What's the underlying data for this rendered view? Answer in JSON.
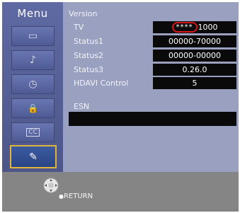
{
  "menu": {
    "title": "Menu",
    "items": [
      {
        "icon": "picture-icon",
        "glyph": "▭"
      },
      {
        "icon": "sound-icon",
        "glyph": "♪"
      },
      {
        "icon": "timer-icon",
        "glyph": "◷"
      },
      {
        "icon": "lock-icon",
        "glyph": "🔒"
      },
      {
        "icon": "closed-caption-icon",
        "glyph": "CC"
      },
      {
        "icon": "setup-icon",
        "glyph": "✎"
      }
    ]
  },
  "version": {
    "title": "Version",
    "rows": [
      {
        "label": "TV",
        "value": "1000",
        "masked": "****"
      },
      {
        "label": "Status1",
        "value": "00000-70000"
      },
      {
        "label": "Status2",
        "value": "00000-00000"
      },
      {
        "label": "Status3",
        "value": "0.26.0"
      },
      {
        "label": "HDAVI Control",
        "value": "5"
      }
    ]
  },
  "esn": {
    "title": "ESN",
    "value": ""
  },
  "footer": {
    "return_label": "RETURN"
  },
  "colors": {
    "highlight": "#e2b43a",
    "mask_circle": "#d81818"
  }
}
